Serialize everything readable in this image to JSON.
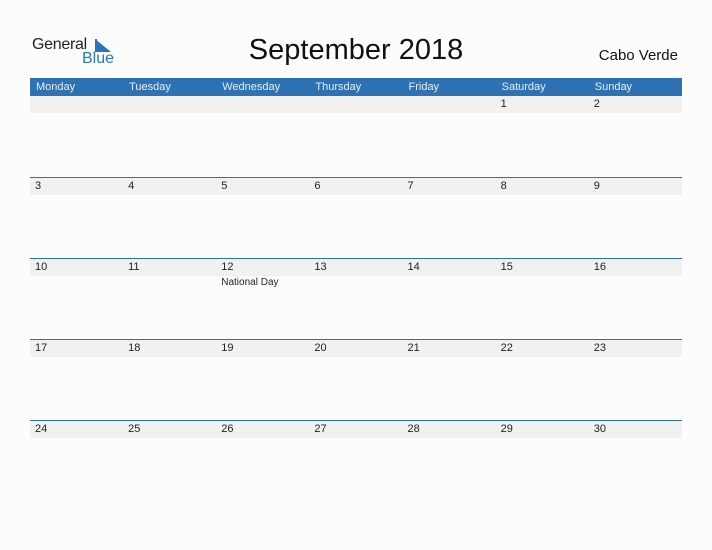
{
  "logo": {
    "word1": "General",
    "word2": "Blue"
  },
  "header": {
    "title": "September 2018",
    "country": "Cabo Verde"
  },
  "colors": {
    "accent": "#2e72b4",
    "date_strip": "#f1f1f1"
  },
  "days": [
    "Monday",
    "Tuesday",
    "Wednesday",
    "Thursday",
    "Friday",
    "Saturday",
    "Sunday"
  ],
  "weeks": [
    {
      "dates": [
        "",
        "",
        "",
        "",
        "",
        "1",
        "2"
      ],
      "events": [
        "",
        "",
        "",
        "",
        "",
        "",
        ""
      ]
    },
    {
      "dates": [
        "3",
        "4",
        "5",
        "6",
        "7",
        "8",
        "9"
      ],
      "events": [
        "",
        "",
        "",
        "",
        "",
        "",
        ""
      ]
    },
    {
      "dates": [
        "10",
        "11",
        "12",
        "13",
        "14",
        "15",
        "16"
      ],
      "events": [
        "",
        "",
        "National Day",
        "",
        "",
        "",
        ""
      ]
    },
    {
      "dates": [
        "17",
        "18",
        "19",
        "20",
        "21",
        "22",
        "23"
      ],
      "events": [
        "",
        "",
        "",
        "",
        "",
        "",
        ""
      ]
    },
    {
      "dates": [
        "24",
        "25",
        "26",
        "27",
        "28",
        "29",
        "30"
      ],
      "events": [
        "",
        "",
        "",
        "",
        "",
        "",
        ""
      ]
    }
  ]
}
